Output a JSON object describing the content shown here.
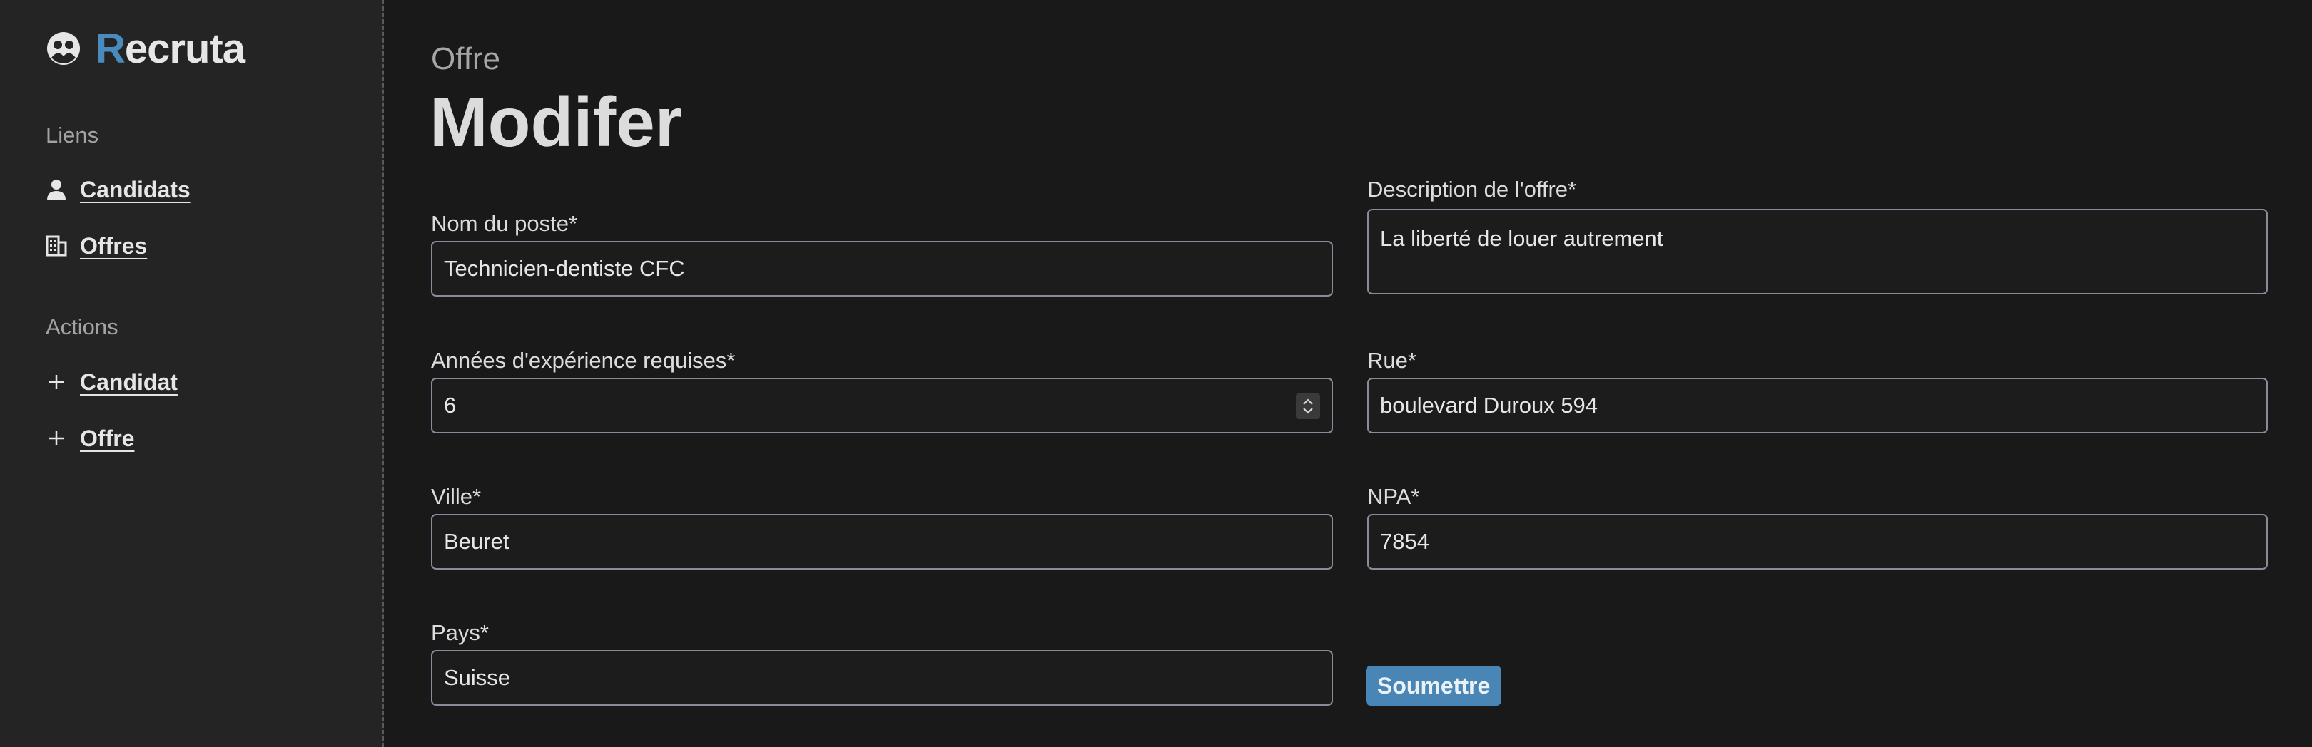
{
  "app": {
    "name_initial": "R",
    "name_rest": "ecruta",
    "accent_color": "#4a8bbd"
  },
  "sidebar": {
    "links_title": "Liens",
    "links": [
      {
        "label": "Candidats",
        "icon": "person-icon"
      },
      {
        "label": "Offres",
        "icon": "building-icon"
      }
    ],
    "actions_title": "Actions",
    "actions": [
      {
        "label": "Candidat",
        "icon": "plus-icon"
      },
      {
        "label": "Offre",
        "icon": "plus-icon"
      }
    ]
  },
  "header": {
    "breadcrumb": "Offre",
    "title": "Modifer"
  },
  "form": {
    "nom_du_poste": {
      "label": "Nom du poste*",
      "value": "Technicien-dentiste CFC"
    },
    "description": {
      "label": "Description de l'offre*",
      "value": "La liberté de louer autrement"
    },
    "experience": {
      "label": "Années d'expérience requises*",
      "value": "6"
    },
    "rue": {
      "label": "Rue*",
      "value": "boulevard Duroux 594"
    },
    "ville": {
      "label": "Ville*",
      "value": "Beuret"
    },
    "npa": {
      "label": "NPA*",
      "value": "7854"
    },
    "pays": {
      "label": "Pays*",
      "value": "Suisse"
    },
    "submit_label": "Soumettre"
  }
}
